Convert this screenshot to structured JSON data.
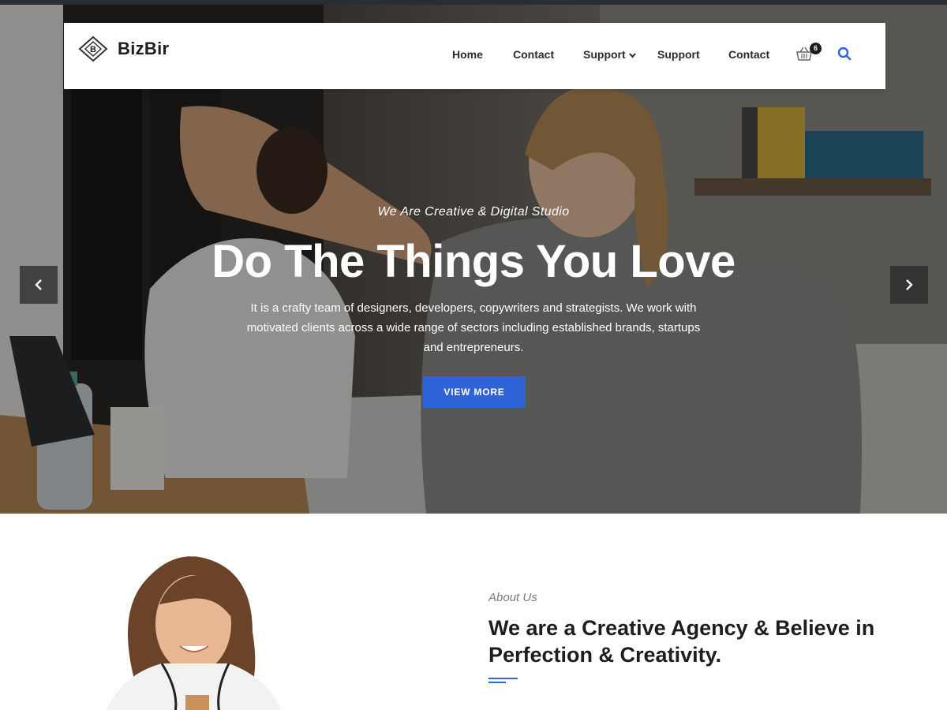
{
  "brand": {
    "name": "BizBir",
    "mark_letter": "B"
  },
  "nav": {
    "items": [
      {
        "label": "Home"
      },
      {
        "label": "Contact"
      },
      {
        "label": "Support",
        "has_dropdown": true
      },
      {
        "label": "Support"
      },
      {
        "label": "Contact"
      }
    ],
    "cart_count": "6",
    "icons": {
      "cart": "basket-icon",
      "search": "search-icon",
      "dropdown": "chevron-down-icon"
    }
  },
  "hero": {
    "tagline": "We Are Creative & Digital Studio",
    "title": "Do The Things You Love",
    "description": "It is a crafty team of designers, developers, copywriters and strategists. We work with motivated clients across a wide range of sectors including established brands, startups and entrepreneurs.",
    "button_label": "VIEW MORE",
    "arrows": {
      "prev": "chevron-left-icon",
      "next": "chevron-right-icon"
    }
  },
  "about": {
    "kicker": "About Us",
    "title": "We are a Creative Agency & Believe in Perfection & Creativity.",
    "text": ""
  },
  "colors": {
    "accent": "#2f63d8",
    "text_dark": "#1d1d1d",
    "overlay": "#000000"
  }
}
